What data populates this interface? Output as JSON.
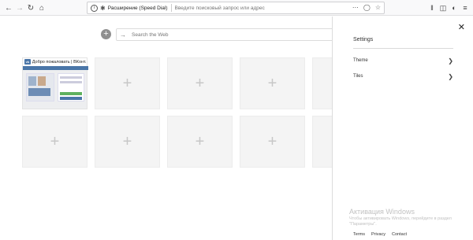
{
  "toolbar": {
    "url_label": "Расширение (Speed Dial)",
    "url_placeholder": "Введите поисковый запрос или адрес"
  },
  "speed_dial": {
    "search_placeholder": "Search the Web",
    "tiles": [
      {
        "label": "Добро пожаловать | ВКонт...",
        "icon": "vk-icon",
        "filled": true
      },
      {
        "filled": false
      },
      {
        "filled": false
      },
      {
        "filled": false
      },
      {
        "filled": false
      },
      {
        "filled": false
      },
      {
        "filled": false
      },
      {
        "filled": false
      },
      {
        "filled": false
      },
      {
        "filled": false
      }
    ]
  },
  "settings_panel": {
    "title": "Settings",
    "items": [
      {
        "label": "Theme"
      },
      {
        "label": "Tiles"
      }
    ],
    "watermark_title": "Активация Windows",
    "watermark_sub": "Чтобы активировать Windows, перейдите в раздел \"Параметры\".",
    "footer": {
      "terms": "Terms",
      "privacy": "Privacy",
      "contact": "Contact"
    }
  },
  "colors": {
    "vk": "#4a76a8",
    "tile_bg": "#f4f4f4",
    "toolbar_bg": "#f9f9fa"
  }
}
